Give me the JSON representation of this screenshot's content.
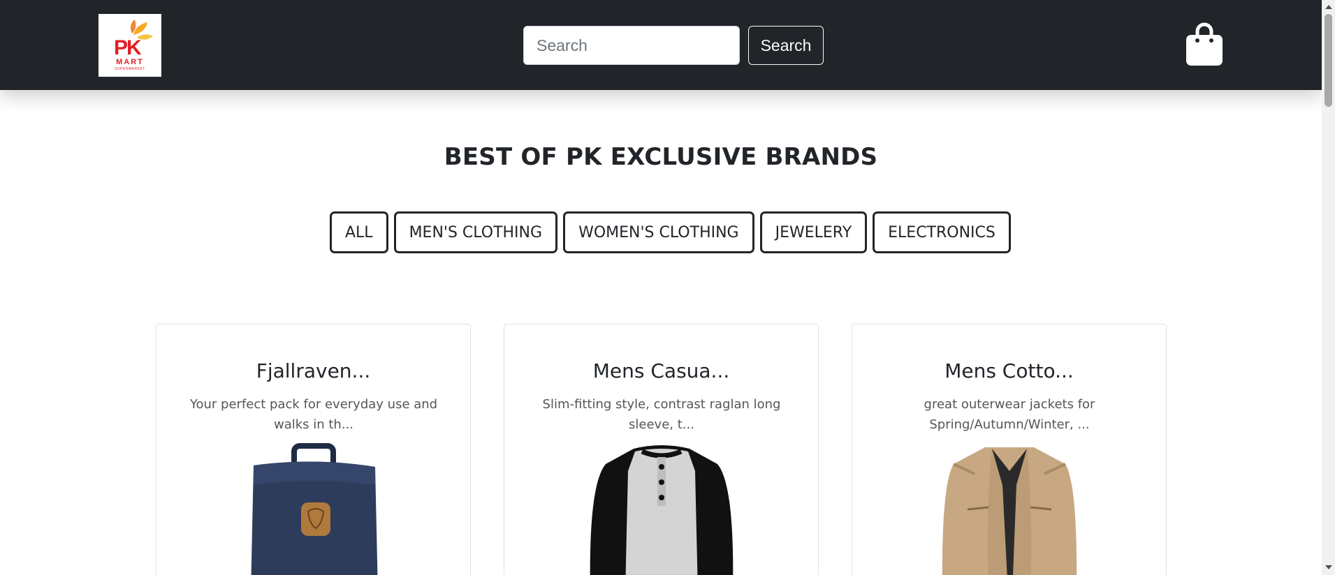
{
  "header": {
    "logo_text": "PK",
    "logo_subtext": "MART",
    "logo_tag": "SUPERMARKET",
    "search": {
      "placeholder": "Search",
      "value": ""
    },
    "search_button": "Search",
    "cart_icon": "shopping-bag-icon"
  },
  "main": {
    "heading": "BEST OF PK EXCLUSIVE BRANDS",
    "filters": [
      "ALL",
      "MEN'S CLOTHING",
      "WOMEN'S CLOTHING",
      "JEWELERY",
      "ELECTRONICS"
    ],
    "products": [
      {
        "title": "Fjallraven...",
        "description": "Your perfect pack for everyday use and walks in th...",
        "image": "backpack"
      },
      {
        "title": "Mens Casua...",
        "description": "Slim-fitting style, contrast raglan long sleeve, t...",
        "image": "raglan-shirt"
      },
      {
        "title": "Mens Cotto...",
        "description": "great outerwear jackets for Spring/Autumn/Winter, ...",
        "image": "cotton-jacket"
      }
    ]
  },
  "colors": {
    "navbar": "#212529",
    "text": "#212529",
    "brand_red": "#e31e24",
    "brand_orange": "#f7a823"
  }
}
